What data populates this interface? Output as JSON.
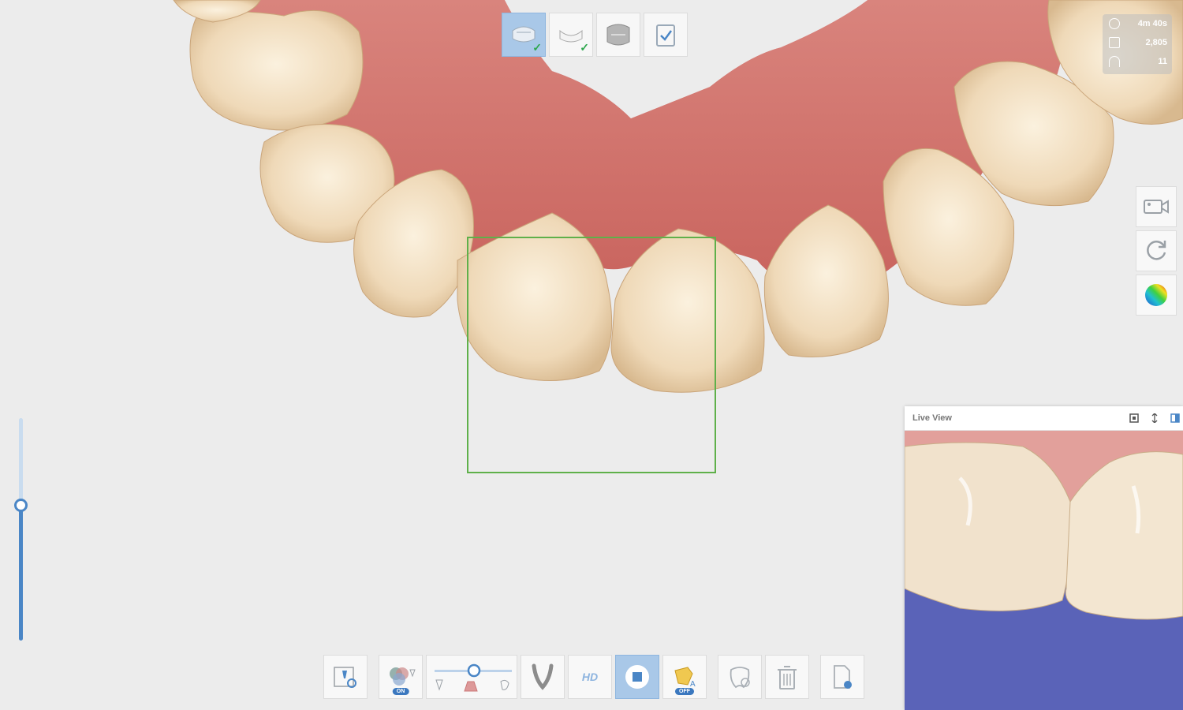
{
  "scan_stats": {
    "time": "4m 40s",
    "image_count": "2,805",
    "third_value": "11"
  },
  "steps": [
    {
      "name": "upper-jaw",
      "completed": true,
      "active": true
    },
    {
      "name": "lower-jaw",
      "completed": true,
      "active": false
    },
    {
      "name": "occlusion",
      "completed": false,
      "active": false
    },
    {
      "name": "review",
      "completed": false,
      "active": false
    }
  ],
  "live_view": {
    "title": "Live View"
  },
  "toolbar": {
    "hd_label": "HD",
    "color_toggle": "ON",
    "ai_toggle": "OFF"
  },
  "slider": {
    "level": 0.6
  },
  "colors": {
    "accent": "#4a86c6",
    "accent_light": "#a9c8e8",
    "scan_box": "#5fb04a",
    "gum": "#d87a74",
    "tooth": "#f3e2c8"
  }
}
